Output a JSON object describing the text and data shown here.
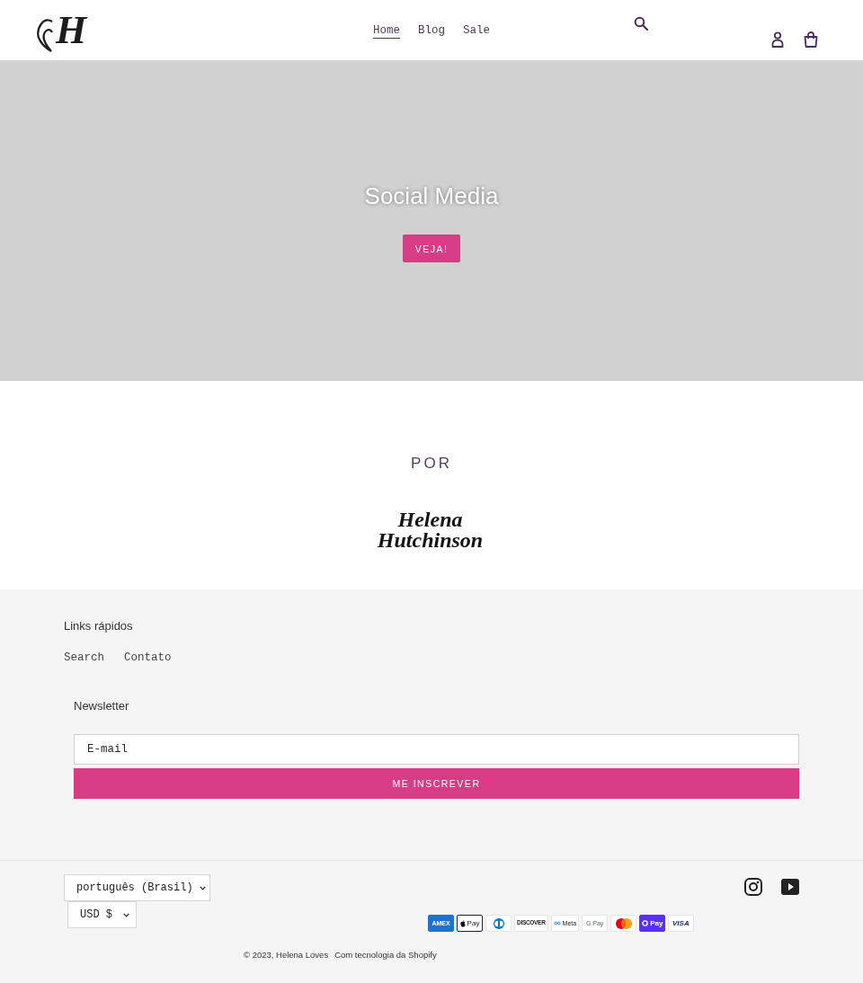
{
  "header": {
    "logo_letter": "H",
    "nav": [
      {
        "label": "Home",
        "selected": true
      },
      {
        "label": "Blog",
        "selected": false
      },
      {
        "label": "Sale",
        "selected": false
      }
    ]
  },
  "hero": {
    "title": "Social Media",
    "button": "VEJA!"
  },
  "brand_section": {
    "heading": "POR",
    "logo_lines": [
      "Helena",
      "Hutchinson"
    ]
  },
  "footer": {
    "links_heading": "Links rápidos",
    "links": [
      "Search",
      "Contato"
    ],
    "newsletter": {
      "heading": "Newsletter",
      "email_placeholder": "E-mail",
      "button": "ME INSCREVER"
    },
    "language_select": "português (Brasil)",
    "currency_select": "USD $",
    "payment_methods": [
      {
        "kind": "amex",
        "label": "AMEX"
      },
      {
        "kind": "apple",
        "label": "Pay"
      },
      {
        "kind": "diners"
      },
      {
        "kind": "discover",
        "label": "DISCOVER"
      },
      {
        "kind": "meta",
        "label": "Meta"
      },
      {
        "kind": "google",
        "label": "G Pay"
      },
      {
        "kind": "mastercard"
      },
      {
        "kind": "shop",
        "label": "Pay"
      },
      {
        "kind": "visa",
        "label": "VISA"
      }
    ],
    "copyright": "© 2023, Helena Loves",
    "powered_by": "Com tecnologia da Shopify"
  }
}
